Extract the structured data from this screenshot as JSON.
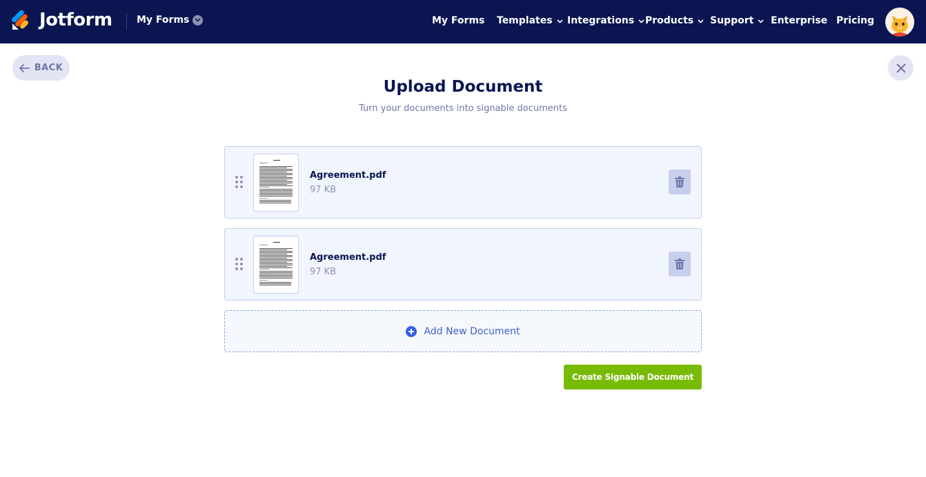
{
  "header": {
    "brand": "Jotform",
    "workspace_dropdown": "My Forms",
    "nav": [
      {
        "label": "My Forms",
        "has_chevron": false
      },
      {
        "label": "Templates",
        "has_chevron": true
      },
      {
        "label": "Integrations",
        "has_chevron": true
      },
      {
        "label": "Products",
        "has_chevron": true
      },
      {
        "label": "Support",
        "has_chevron": true
      },
      {
        "label": "Enterprise",
        "has_chevron": false
      },
      {
        "label": "Pricing",
        "has_chevron": false
      }
    ],
    "avatar_icon": "cat-avatar-icon"
  },
  "controls": {
    "back_label": "BACK",
    "close_icon": "close-icon"
  },
  "page": {
    "title": "Upload Document",
    "subtitle": "Turn your documents into signable documents"
  },
  "documents": [
    {
      "name": "Agreement.pdf",
      "size": "97 KB"
    },
    {
      "name": "Agreement.pdf",
      "size": "97 KB"
    }
  ],
  "add_document_label": "Add New Document",
  "create_button_label": "Create Signable Document",
  "colors": {
    "header_bg": "#0a1551",
    "accent_green": "#78bb07",
    "accent_blue": "#3360e6",
    "card_bg": "#f1f5fd"
  }
}
